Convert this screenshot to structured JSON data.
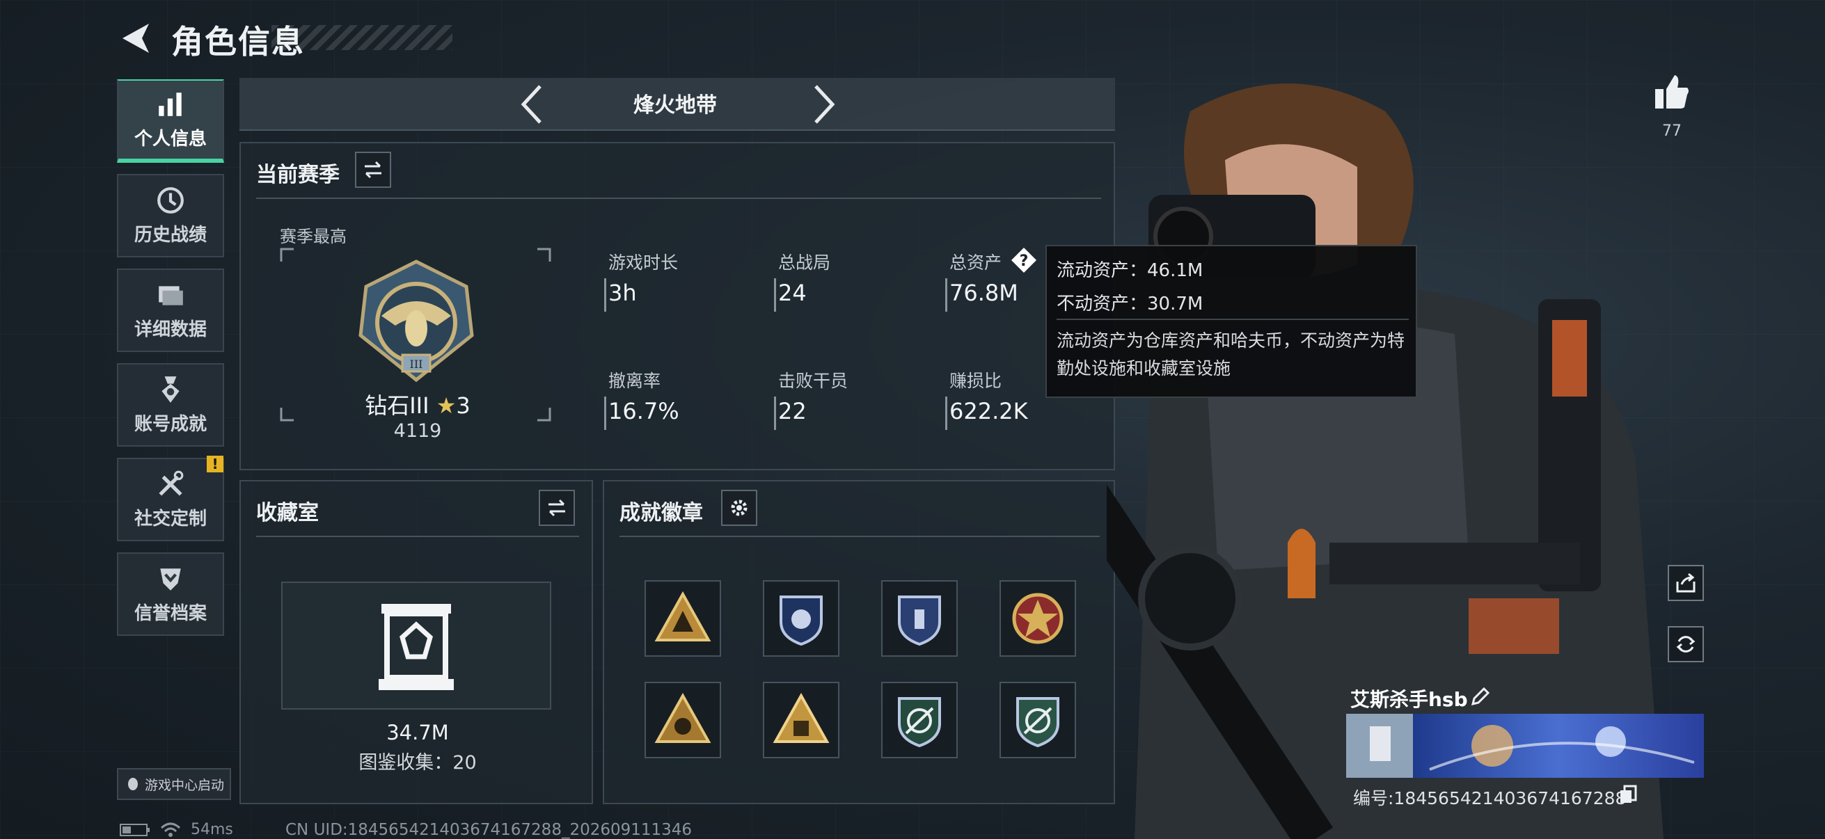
{
  "header": {
    "title": "角色信息"
  },
  "sidebar": {
    "items": [
      {
        "label": "个人信息",
        "icon": "bar-chart-icon",
        "active": true
      },
      {
        "label": "历史战绩",
        "icon": "clock-icon",
        "active": false
      },
      {
        "label": "详细数据",
        "icon": "folder-icon",
        "active": false
      },
      {
        "label": "账号成就",
        "icon": "medal-icon",
        "active": false
      },
      {
        "label": "社交定制",
        "icon": "tools-icon",
        "active": false,
        "badge": "!"
      },
      {
        "label": "信誉档案",
        "icon": "shield-check-icon",
        "active": false
      }
    ],
    "launch_label": "游戏中心启动"
  },
  "mode": {
    "title": "烽火地带"
  },
  "season": {
    "title": "当前赛季",
    "best_label": "赛季最高",
    "rank_name": "钻石III",
    "rank_stars": "3",
    "rank_score": "4119",
    "stats": [
      {
        "label": "游戏时长",
        "value": "3h"
      },
      {
        "label": "总战局",
        "value": "24"
      },
      {
        "label": "总资产",
        "value": "76.8M"
      },
      {
        "label": "撤离率",
        "value": "16.7%"
      },
      {
        "label": "击败干员",
        "value": "22"
      },
      {
        "label": "赚损比",
        "value": "622.2K"
      }
    ]
  },
  "tooltip": {
    "liquid": "流动资产：46.1M",
    "fixed": "不动资产：30.7M",
    "description": "流动资产为仓库资产和哈夫币，不动资产为特勤处设施和收藏室设施"
  },
  "collection": {
    "title": "收藏室",
    "value": "34.7M",
    "count_text": "图鉴收集：20"
  },
  "achievements": {
    "title": "成就徽章",
    "badges": [
      "gold-triangle-badge",
      "blue-shield-badge",
      "blue-shield-badge-2",
      "red-star-badge",
      "gold-triangle-badge-2",
      "gold-triangle-badge-3",
      "green-shield-badge",
      "green-shield-badge-2"
    ]
  },
  "profile": {
    "likes": "77",
    "name": "艾斯杀手hsb",
    "id_text": "编号:18456542140367416728​8"
  },
  "footer": {
    "ping": "54ms",
    "uid": "CN UID:184565421403674167288_202609111346"
  },
  "colors": {
    "accent": "#49d3a3",
    "warning": "#e6b422",
    "tooltip_bg": "#0c0e10"
  }
}
